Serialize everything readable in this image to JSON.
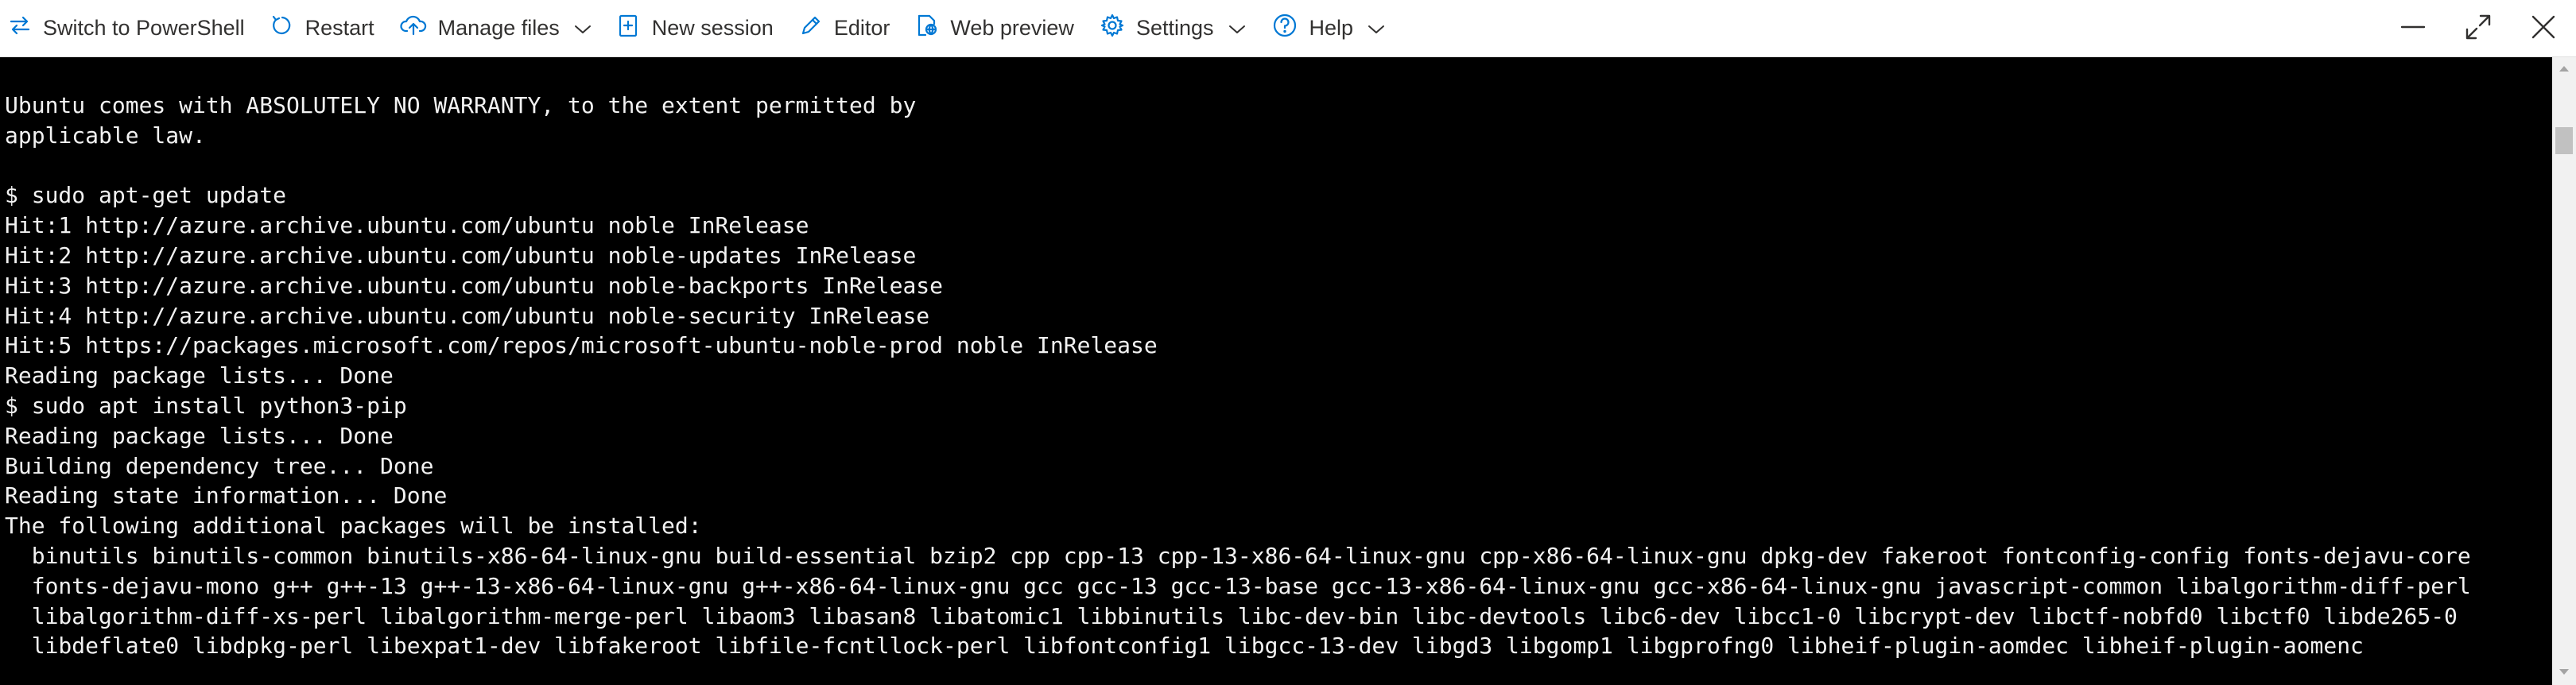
{
  "toolbar": {
    "switch_label": "Switch to PowerShell",
    "restart_label": "Restart",
    "manage_files_label": "Manage files",
    "new_session_label": "New session",
    "editor_label": "Editor",
    "web_preview_label": "Web preview",
    "settings_label": "Settings",
    "help_label": "Help"
  },
  "terminal": {
    "lines": [
      "Ubuntu comes with ABSOLUTELY NO WARRANTY, to the extent permitted by",
      "applicable law.",
      "",
      "$ sudo apt-get update",
      "Hit:1 http://azure.archive.ubuntu.com/ubuntu noble InRelease",
      "Hit:2 http://azure.archive.ubuntu.com/ubuntu noble-updates InRelease",
      "Hit:3 http://azure.archive.ubuntu.com/ubuntu noble-backports InRelease",
      "Hit:4 http://azure.archive.ubuntu.com/ubuntu noble-security InRelease",
      "Hit:5 https://packages.microsoft.com/repos/microsoft-ubuntu-noble-prod noble InRelease",
      "Reading package lists... Done",
      "$ sudo apt install python3-pip",
      "Reading package lists... Done",
      "Building dependency tree... Done",
      "Reading state information... Done",
      "The following additional packages will be installed:",
      "  binutils binutils-common binutils-x86-64-linux-gnu build-essential bzip2 cpp cpp-13 cpp-13-x86-64-linux-gnu cpp-x86-64-linux-gnu dpkg-dev fakeroot fontconfig-config fonts-dejavu-core",
      "  fonts-dejavu-mono g++ g++-13 g++-13-x86-64-linux-gnu g++-x86-64-linux-gnu gcc gcc-13 gcc-13-base gcc-13-x86-64-linux-gnu gcc-x86-64-linux-gnu javascript-common libalgorithm-diff-perl",
      "  libalgorithm-diff-xs-perl libalgorithm-merge-perl libaom3 libasan8 libatomic1 libbinutils libc-dev-bin libc-devtools libc6-dev libcc1-0 libcrypt-dev libctf-nobfd0 libctf0 libde265-0",
      "  libdeflate0 libdpkg-perl libexpat1-dev libfakeroot libfile-fcntllock-perl libfontconfig1 libgcc-13-dev libgd3 libgomp1 libgprofng0 libheif-plugin-aomdec libheif-plugin-aomenc"
    ]
  },
  "icons": {
    "switch": "switch-arrows-icon",
    "restart": "restart-icon",
    "manage_files": "cloud-upload-icon",
    "new_session": "new-session-icon",
    "editor": "pencil-icon",
    "web_preview": "web-preview-icon",
    "settings": "gear-icon",
    "help": "help-icon"
  },
  "colors": {
    "accent": "#0078d4",
    "terminal_bg": "#000000",
    "terminal_fg": "#f2f2f2",
    "toolbar_text": "#323130"
  }
}
